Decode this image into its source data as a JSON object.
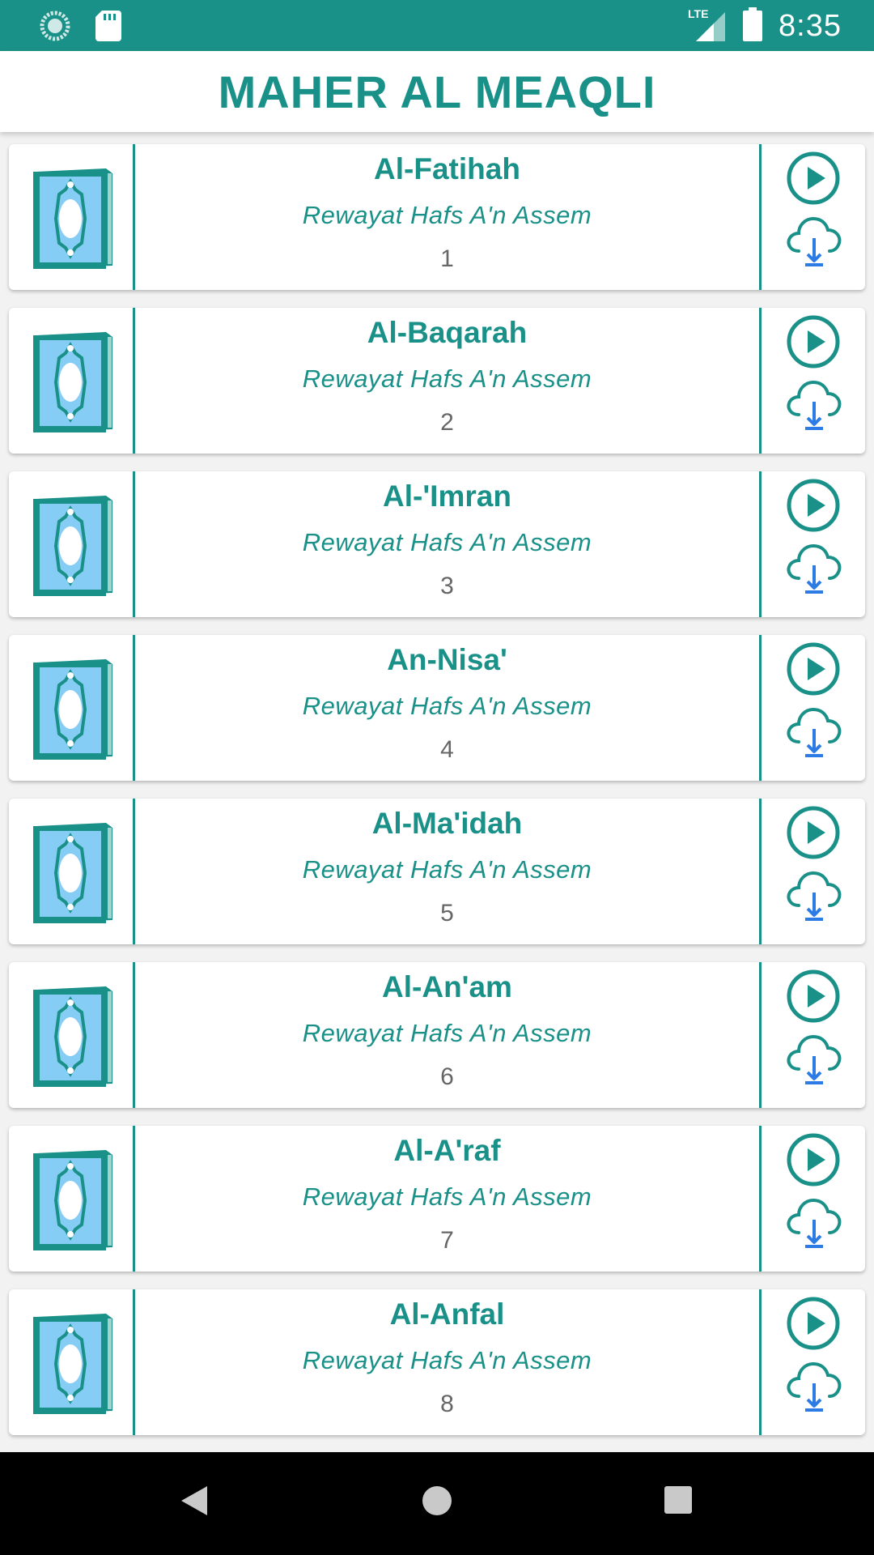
{
  "status_bar": {
    "time": "8:35",
    "network": "LTE",
    "icons": [
      "sync-icon",
      "sd-card-icon",
      "signal-icon",
      "battery-icon"
    ]
  },
  "header": {
    "title": "MAHER AL MEAQLI"
  },
  "colors": {
    "primary": "#1a9188",
    "download_blue": "#2d7be5",
    "book_light": "#86cdf5"
  },
  "suras": [
    {
      "name": "Al-Fatihah",
      "riwaya": "Rewayat Hafs A'n Assem",
      "number": "1"
    },
    {
      "name": "Al-Baqarah",
      "riwaya": "Rewayat Hafs A'n Assem",
      "number": "2"
    },
    {
      "name": "Al-'Imran",
      "riwaya": "Rewayat Hafs A'n Assem",
      "number": "3"
    },
    {
      "name": "An-Nisa'",
      "riwaya": "Rewayat Hafs A'n Assem",
      "number": "4"
    },
    {
      "name": "Al-Ma'idah",
      "riwaya": "Rewayat Hafs A'n Assem",
      "number": "5"
    },
    {
      "name": "Al-An'am",
      "riwaya": "Rewayat Hafs A'n Assem",
      "number": "6"
    },
    {
      "name": "Al-A'raf",
      "riwaya": "Rewayat Hafs A'n Assem",
      "number": "7"
    },
    {
      "name": "Al-Anfal",
      "riwaya": "Rewayat Hafs A'n Assem",
      "number": "8"
    }
  ],
  "nav": {
    "icons": [
      "back-icon",
      "home-icon",
      "recents-icon"
    ]
  }
}
